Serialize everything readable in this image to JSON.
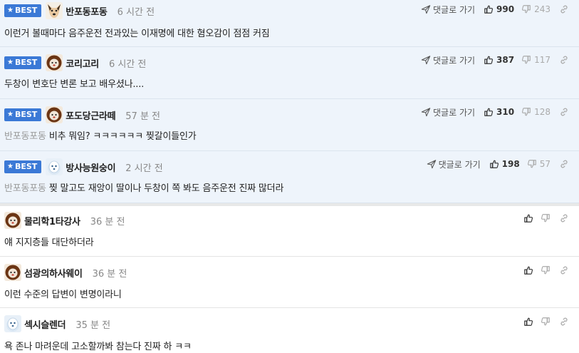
{
  "labels": {
    "best": "BEST",
    "reply_link": "댓글로 가기"
  },
  "best_comments": [
    {
      "nick": "반포동포동",
      "time": "6 시간 전",
      "mention": "",
      "text": "이런거 볼때마다 음주운전 전과있는 이재명에 대한 혐오감이 점점 커짐",
      "likes": "990",
      "dislikes": "243",
      "avatar": "dog"
    },
    {
      "nick": "코리고리",
      "time": "6 시간 전",
      "mention": "",
      "text": "두창이 변호단 변론 보고 배우셨나....",
      "likes": "387",
      "dislikes": "117",
      "avatar": "lion"
    },
    {
      "nick": "포도당근라떼",
      "time": "57 분 전",
      "mention": "반포동포동",
      "text": "비추 뭐임? ㅋㅋㅋㅋㅋㅋ 찢갈이들인가",
      "likes": "310",
      "dislikes": "128",
      "avatar": "lion"
    },
    {
      "nick": "방사능원숭이",
      "time": "2 시간 전",
      "mention": "반포동포동",
      "text": "찢 말고도 재앙이 딸이나 두창이 쪽 봐도 음주운전 진짜 많더라",
      "likes": "198",
      "dislikes": "57",
      "avatar": "seal"
    }
  ],
  "comments": [
    {
      "nick": "물리학1타강사",
      "time": "36 분 전",
      "text": "얘 지지층들 대단하더라",
      "avatar": "lion"
    },
    {
      "nick": "섬광의하사웨이",
      "time": "36 분 전",
      "text": "이런 수준의 답변이 변명이라니",
      "avatar": "lion"
    },
    {
      "nick": "섹시슬렌더",
      "time": "35 분 전",
      "text": "욕 존나 마려운데 고소할까봐 참는다 진짜 하 ㅋㅋ",
      "avatar": "seal"
    }
  ]
}
